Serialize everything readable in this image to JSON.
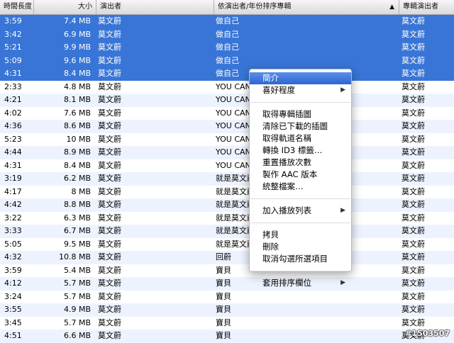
{
  "header": {
    "time": "時間長度",
    "size": "大小",
    "artist": "演出者",
    "album": "依演出者/年份排序專輯",
    "sort_indicator": "▲",
    "album_artist": "專輯演出者"
  },
  "rows": [
    {
      "time": "3:59",
      "size": "7.4 MB",
      "artist": "莫文蔚",
      "album": "做自己",
      "album_artist": "莫文蔚",
      "selected": true
    },
    {
      "time": "3:42",
      "size": "6.9 MB",
      "artist": "莫文蔚",
      "album": "做自己",
      "album_artist": "莫文蔚",
      "selected": true
    },
    {
      "time": "5:21",
      "size": "9.9 MB",
      "artist": "莫文蔚",
      "album": "做自己",
      "album_artist": "莫文蔚",
      "selected": true
    },
    {
      "time": "5:09",
      "size": "9.6 MB",
      "artist": "莫文蔚",
      "album": "做自己",
      "album_artist": "莫文蔚",
      "selected": true
    },
    {
      "time": "4:31",
      "size": "8.4 MB",
      "artist": "莫文蔚",
      "album": "做自己",
      "album_artist": "莫文蔚",
      "selected": true
    },
    {
      "time": "2:33",
      "size": "4.8 MB",
      "artist": "莫文蔚",
      "album": "YOU CAN",
      "album_artist": "莫文蔚",
      "selected": false
    },
    {
      "time": "4:21",
      "size": "8.1 MB",
      "artist": "莫文蔚",
      "album": "YOU CAN",
      "album_artist": "莫文蔚",
      "selected": false
    },
    {
      "time": "4:02",
      "size": "7.6 MB",
      "artist": "莫文蔚",
      "album": "YOU CAN",
      "album_artist": "莫文蔚",
      "selected": false
    },
    {
      "time": "4:36",
      "size": "8.6 MB",
      "artist": "莫文蔚",
      "album": "YOU CAN",
      "album_artist": "莫文蔚",
      "selected": false
    },
    {
      "time": "5:23",
      "size": "10 MB",
      "artist": "莫文蔚",
      "album": "YOU CAN",
      "album_artist": "莫文蔚",
      "selected": false
    },
    {
      "time": "4:44",
      "size": "8.9 MB",
      "artist": "莫文蔚",
      "album": "YOU CAN",
      "album_artist": "莫文蔚",
      "selected": false
    },
    {
      "time": "4:31",
      "size": "8.4 MB",
      "artist": "莫文蔚",
      "album": "YOU CAN",
      "album_artist": "莫文蔚",
      "selected": false
    },
    {
      "time": "3:19",
      "size": "6.2 MB",
      "artist": "莫文蔚",
      "album": "就是莫文蔚",
      "album_artist": "莫文蔚",
      "selected": false
    },
    {
      "time": "4:17",
      "size": "8 MB",
      "artist": "莫文蔚",
      "album": "就是莫文蔚",
      "album_artist": "莫文蔚",
      "selected": false
    },
    {
      "time": "4:42",
      "size": "8.8 MB",
      "artist": "莫文蔚",
      "album": "就是莫文蔚",
      "album_artist": "莫文蔚",
      "selected": false
    },
    {
      "time": "3:22",
      "size": "6.3 MB",
      "artist": "莫文蔚",
      "album": "就是莫文蔚",
      "album_artist": "莫文蔚",
      "selected": false
    },
    {
      "time": "3:33",
      "size": "6.7 MB",
      "artist": "莫文蔚",
      "album": "就是莫文蔚",
      "album_artist": "莫文蔚",
      "selected": false
    },
    {
      "time": "5:05",
      "size": "9.5 MB",
      "artist": "莫文蔚",
      "album": "就是莫文蔚",
      "album_artist": "莫文蔚",
      "selected": false
    },
    {
      "time": "4:32",
      "size": "10.8 MB",
      "artist": "莫文蔚",
      "album": "回蔚",
      "album_artist": "莫文蔚",
      "selected": false
    },
    {
      "time": "3:59",
      "size": "5.4 MB",
      "artist": "莫文蔚",
      "album": "寶貝",
      "album_artist": "莫文蔚",
      "selected": false
    },
    {
      "time": "4:12",
      "size": "5.7 MB",
      "artist": "莫文蔚",
      "album": "寶貝",
      "album_artist": "莫文蔚",
      "selected": false
    },
    {
      "time": "3:24",
      "size": "5.7 MB",
      "artist": "莫文蔚",
      "album": "寶貝",
      "album_artist": "莫文蔚",
      "selected": false
    },
    {
      "time": "3:55",
      "size": "4.9 MB",
      "artist": "莫文蔚",
      "album": "寶貝",
      "album_artist": "莫文蔚",
      "selected": false
    },
    {
      "time": "3:45",
      "size": "5.7 MB",
      "artist": "莫文蔚",
      "album": "寶貝",
      "album_artist": "莫文蔚",
      "selected": false
    },
    {
      "time": "4:51",
      "size": "6.6 MB",
      "artist": "莫文蔚",
      "album": "寶貝",
      "album_artist": "莫文蔚",
      "selected": false
    }
  ],
  "context_menu": {
    "groups": [
      [
        {
          "label": "簡介",
          "highlighted": true,
          "submenu": false
        },
        {
          "label": "喜好程度",
          "highlighted": false,
          "submenu": true
        }
      ],
      [
        {
          "label": "取得專輯插圖",
          "highlighted": false,
          "submenu": false
        },
        {
          "label": "清除已下載的插圖",
          "highlighted": false,
          "submenu": false
        },
        {
          "label": "取得軌道名稱",
          "highlighted": false,
          "submenu": false
        },
        {
          "label": "轉換 ID3 標籤…",
          "highlighted": false,
          "submenu": false
        },
        {
          "label": "重置播放次數",
          "highlighted": false,
          "submenu": false
        },
        {
          "label": "製作 AAC 版本",
          "highlighted": false,
          "submenu": false
        },
        {
          "label": "統整檔案…",
          "highlighted": false,
          "submenu": false
        }
      ],
      [
        {
          "label": "加入播放列表",
          "highlighted": false,
          "submenu": true
        }
      ],
      [
        {
          "label": "拷貝",
          "highlighted": false,
          "submenu": false
        },
        {
          "label": "刪除",
          "highlighted": false,
          "submenu": false
        },
        {
          "label": "取消勾選所選項目",
          "highlighted": false,
          "submenu": false
        }
      ],
      [
        {
          "label": "套用排序欄位",
          "highlighted": false,
          "submenu": true
        }
      ]
    ],
    "submenu_icon": "triangle-right-icon"
  },
  "watermark": "#1503507"
}
